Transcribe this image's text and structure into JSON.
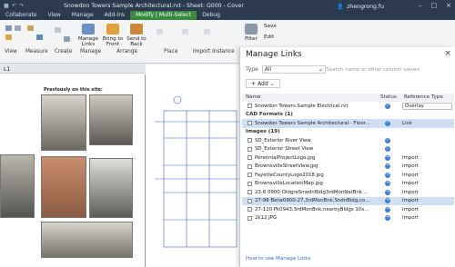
{
  "window": {
    "title": "Snowdon Towers Sample Architectural.rvt - Sheet: G000 - Cover",
    "user": "zhengrong.fu"
  },
  "ribbon": {
    "tabs": [
      "Collaborate",
      "View",
      "Manage",
      "Add-Ins",
      "Modify | Multi-Select",
      "Debug"
    ],
    "buttons": {
      "manage_links": "Manage Links",
      "bring_to_front": "Bring to Front",
      "send_to_back": "Send to Back",
      "filter": "Filter",
      "save": "Save",
      "edit": "Edit"
    },
    "panels": [
      "View",
      "Measure",
      "Create",
      "Manage",
      "Arrange",
      "Place",
      "Import Instance"
    ]
  },
  "view": {
    "tab": "L1",
    "sheet_caption": "Previously on this site:"
  },
  "dialog": {
    "title": "Manage Links",
    "type_label": "Type",
    "type_value": "All",
    "search_placeholder": "Search name or other column values",
    "add_label": "Add",
    "columns": {
      "name": "Name",
      "status": "Status",
      "ref": "Reference Type"
    },
    "top_row": {
      "name": "Snowdon Towers Sample Electrical.rvt",
      "ref": "Overlay"
    },
    "groups": [
      {
        "label": "CAD Formats (1)",
        "rows": [
          {
            "name": "Snowdon Towers Sample Architectural - Floor Plan - ...",
            "ref": "Link",
            "selected": true
          }
        ]
      },
      {
        "label": "Images (19)",
        "rows": [
          {
            "name": "SD_Exterior River View",
            "ref": ""
          },
          {
            "name": "SD_Exterior Street View",
            "ref": ""
          },
          {
            "name": "PerennialProjectLogo.jpg",
            "ref": "Import"
          },
          {
            "name": "BrownsvilleStreetView.jpg",
            "ref": "Import"
          },
          {
            "name": "FayetteCountyLogo2018.jpg",
            "ref": "Import"
          },
          {
            "name": "BrownsvilleLocationMap.jpg",
            "ref": "Import"
          },
          {
            "name": "23-8 0900-OldgreSnwdnBldg3rdMonNatBnk 10x7.8...",
            "ref": "Import"
          },
          {
            "name": "27-98 Betw0900-27,3rdMonBnk,SndnBldg,color 10x6...",
            "ref": "Import",
            "selected": true
          },
          {
            "name": "27-120 Pk0943,3rdMonBnk,nearbyBldgs 10x6...",
            "ref": "Import"
          },
          {
            "name": "2k12.JPG",
            "ref": "Import"
          }
        ]
      }
    ],
    "help_link": "How to use Manage Links"
  }
}
